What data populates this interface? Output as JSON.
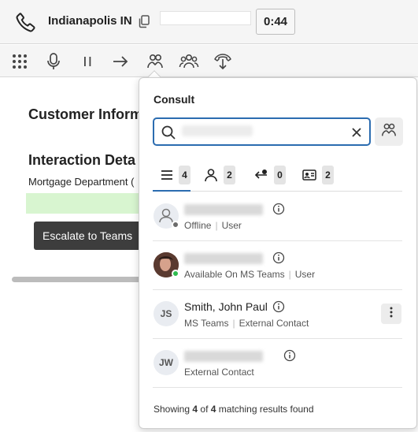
{
  "header": {
    "title": "Indianapolis IN",
    "timer": "0:44",
    "phone_icon": "phone-icon",
    "copy_icon": "copy-icon"
  },
  "toolbar": {
    "icons": [
      "dialpad-icon",
      "microphone-icon",
      "pause-icon",
      "transfer-arrow-icon",
      "consult-icon",
      "conference-icon",
      "park-icon"
    ]
  },
  "background": {
    "customer_title": "Customer Inform",
    "interaction_title": "Interaction Deta",
    "department": "Mortgage Department (",
    "escalate_label": "Escalate to Teams"
  },
  "consult": {
    "title": "Consult",
    "search_value_redacted": true,
    "tabs": [
      {
        "icon": "all-list-icon",
        "count": "4",
        "active": true
      },
      {
        "icon": "user-icon",
        "count": "2"
      },
      {
        "icon": "queue-transfer-icon",
        "count": "0"
      },
      {
        "icon": "contact-card-icon",
        "count": "2"
      }
    ],
    "results": [
      {
        "name": "",
        "status": "Offline",
        "type": "User",
        "initials": "",
        "status_color": "#6b6b6b"
      },
      {
        "name": "",
        "status": "Available On MS Teams",
        "type": "User",
        "initials": "",
        "status_color": "#2ebc4f"
      },
      {
        "name": "Smith, John Paul",
        "status": "MS Teams",
        "type": "External Contact",
        "initials": "JS"
      },
      {
        "name": "",
        "status": "External Contact",
        "type": "",
        "initials": "JW"
      }
    ],
    "footer": {
      "prefix": "Showing",
      "shown": "4",
      "of": "of",
      "total": "4",
      "suffix": "matching results found"
    }
  },
  "colors": {
    "accent": "#2b6cb0",
    "available": "#2ebc4f",
    "offline": "#6b6b6b",
    "escalate_bg": "#3d3d3d",
    "highlight": "#d8f5d0"
  }
}
